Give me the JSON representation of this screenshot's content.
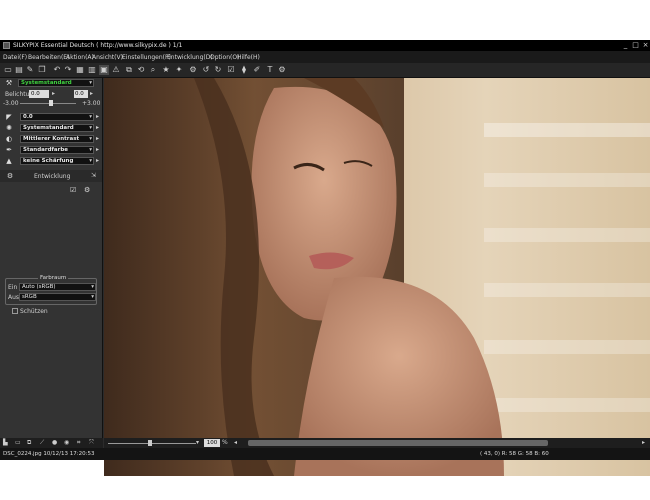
{
  "window": {
    "title": "SILKYPIX Essential Deutsch ( http://www.silkypix.de )   1/1"
  },
  "menu": [
    "Datei(F)",
    "Bearbeiten(E)",
    "Aktion(A)",
    "Ansicht(V)",
    "Einstellungen(P)",
    "Entwicklung(D)",
    "Option(O)",
    "Hilfe(H)"
  ],
  "left": {
    "preset": "Systemstandard",
    "exposure_label": "Belichtung",
    "exposure_value": "0.0",
    "exposure_value2": "0.0",
    "exposure_min": "-3.00",
    "exposure_max": "+3.00",
    "dd_wb": "0.0",
    "dd_tone": "Systemstandard",
    "dd_contrast": "Mittlerer Kontrast",
    "dd_color": "Standardfarbe",
    "dd_sharp": "keine Schärfung",
    "section": "Entwicklung",
    "colorspace_title": "Farbraum",
    "in_label": "Ein",
    "in_value": "Auto (sRGB)",
    "out_label": "Aus",
    "out_value": "sRGB",
    "protect_label": "Schützen"
  },
  "zoom": "100",
  "zoom_unit": "%",
  "status": {
    "file": "DSC_0224.jpg 10/12/13 17:20:53",
    "coords": "(    43,      0) R:  58  G:  58  B:  60"
  },
  "colors": {
    "accent": "#3fae3f",
    "app_bg": "#2b2b2b"
  }
}
